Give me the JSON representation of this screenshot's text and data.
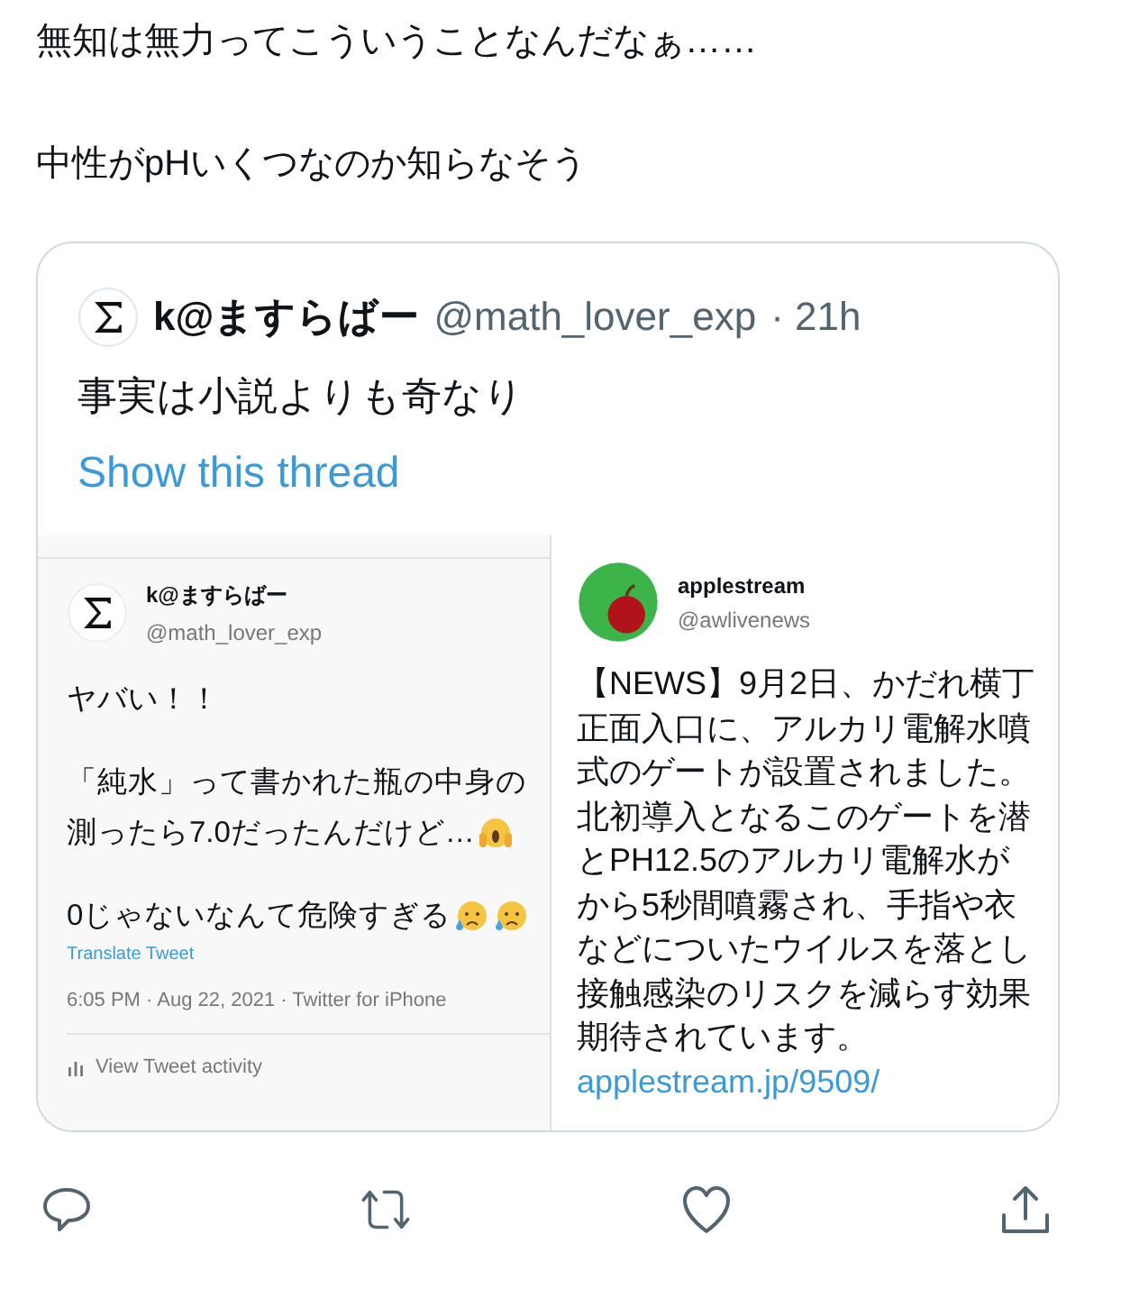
{
  "post": {
    "lines": [
      "無知は無力ってこういうことなんだなぁ……",
      "中性がpHいくつなのか知らなそう"
    ]
  },
  "quote": {
    "author": {
      "name": "k@ますらばー",
      "handle": "@math_lover_exp",
      "time": "· 21h"
    },
    "text": "事実は小説よりも奇なり",
    "thread_link": "Show this thread"
  },
  "media": [
    {
      "kind": "tweet",
      "name": "k@ますらばー",
      "handle": "@math_lover_exp",
      "lines": [
        {
          "kind": "text",
          "text": "ヤバい！！"
        },
        {
          "kind": "blank"
        },
        {
          "kind": "text",
          "text": "「純水」って書かれた瓶の中身の"
        },
        {
          "kind": "text",
          "text": "測ったら7.0だったんだけど…",
          "icons": [
            {
              "kind": "scream"
            }
          ]
        },
        {
          "kind": "blank"
        },
        {
          "kind": "text",
          "text": "0じゃないなんて危険すぎる",
          "icons": [
            {
              "kind": "worried"
            },
            {
              "kind": "worried"
            }
          ]
        }
      ],
      "translate": "Translate Tweet",
      "meta": "6:05 PM · Aug 22, 2021 · Twitter for iPhone",
      "activity": "View Tweet activity"
    },
    {
      "kind": "news",
      "name": "applestream",
      "handle": "@awlivenews",
      "lines": [
        "【NEWS】9月2日、かだれ横丁",
        "正面入口に、アルカリ電解水噴",
        "式のゲートが設置されました。",
        "北初導入となるこのゲートを潜",
        "とPH12.5のアルカリ電解水が",
        "から5秒間噴霧され、手指や衣",
        "などについたウイルスを落とし",
        "接触感染のリスクを減らす効果",
        "期待されています。"
      ],
      "link": "applestream.jp/9509/"
    }
  ],
  "actions": [
    {
      "kind": "reply"
    },
    {
      "kind": "retweet"
    },
    {
      "kind": "like"
    },
    {
      "kind": "share"
    }
  ]
}
